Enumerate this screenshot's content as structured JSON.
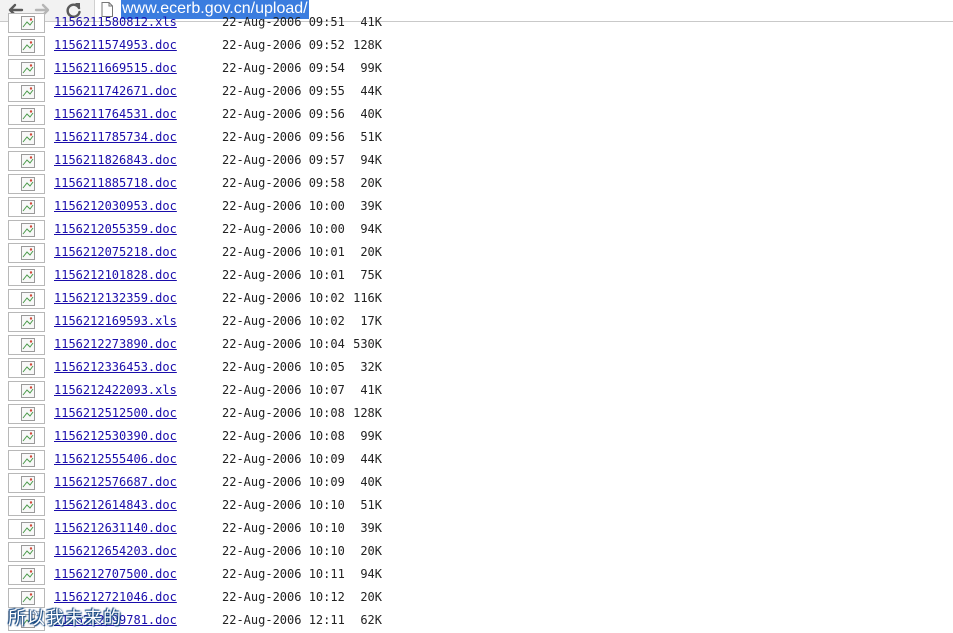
{
  "browser": {
    "url": "www.ecerb.gov.cn/upload/",
    "back_icon": "arrow-left-icon",
    "forward_icon": "arrow-right-icon",
    "reload_icon": "reload-icon",
    "page_icon": "document-icon"
  },
  "listing": {
    "rows": [
      {
        "name": "1156211580812.xls",
        "date": "22-Aug-2006 09:51",
        "size": "41K"
      },
      {
        "name": "1156211574953.doc",
        "date": "22-Aug-2006 09:52",
        "size": "128K"
      },
      {
        "name": "1156211669515.doc",
        "date": "22-Aug-2006 09:54",
        "size": "99K"
      },
      {
        "name": "1156211742671.doc",
        "date": "22-Aug-2006 09:55",
        "size": "44K"
      },
      {
        "name": "1156211764531.doc",
        "date": "22-Aug-2006 09:56",
        "size": "40K"
      },
      {
        "name": "1156211785734.doc",
        "date": "22-Aug-2006 09:56",
        "size": "51K"
      },
      {
        "name": "1156211826843.doc",
        "date": "22-Aug-2006 09:57",
        "size": "94K"
      },
      {
        "name": "1156211885718.doc",
        "date": "22-Aug-2006 09:58",
        "size": "20K"
      },
      {
        "name": "1156212030953.doc",
        "date": "22-Aug-2006 10:00",
        "size": "39K"
      },
      {
        "name": "1156212055359.doc",
        "date": "22-Aug-2006 10:00",
        "size": "94K"
      },
      {
        "name": "1156212075218.doc",
        "date": "22-Aug-2006 10:01",
        "size": "20K"
      },
      {
        "name": "1156212101828.doc",
        "date": "22-Aug-2006 10:01",
        "size": "75K"
      },
      {
        "name": "1156212132359.doc",
        "date": "22-Aug-2006 10:02",
        "size": "116K"
      },
      {
        "name": "1156212169593.xls",
        "date": "22-Aug-2006 10:02",
        "size": "17K"
      },
      {
        "name": "1156212273890.doc",
        "date": "22-Aug-2006 10:04",
        "size": "530K"
      },
      {
        "name": "1156212336453.doc",
        "date": "22-Aug-2006 10:05",
        "size": "32K"
      },
      {
        "name": "1156212422093.xls",
        "date": "22-Aug-2006 10:07",
        "size": "41K"
      },
      {
        "name": "1156212512500.doc",
        "date": "22-Aug-2006 10:08",
        "size": "128K"
      },
      {
        "name": "1156212530390.doc",
        "date": "22-Aug-2006 10:08",
        "size": "99K"
      },
      {
        "name": "1156212555406.doc",
        "date": "22-Aug-2006 10:09",
        "size": "44K"
      },
      {
        "name": "1156212576687.doc",
        "date": "22-Aug-2006 10:09",
        "size": "40K"
      },
      {
        "name": "1156212614843.doc",
        "date": "22-Aug-2006 10:10",
        "size": "51K"
      },
      {
        "name": "1156212631140.doc",
        "date": "22-Aug-2006 10:10",
        "size": "39K"
      },
      {
        "name": "1156212654203.doc",
        "date": "22-Aug-2006 10:10",
        "size": "20K"
      },
      {
        "name": "1156212707500.doc",
        "date": "22-Aug-2006 10:11",
        "size": "94K"
      },
      {
        "name": "1156212721046.doc",
        "date": "22-Aug-2006 10:12",
        "size": "20K"
      },
      {
        "name": "1156212799781.doc",
        "date": "22-Aug-2006 12:11",
        "size": "62K"
      }
    ]
  },
  "watermark": {
    "text": "所以我未来的"
  },
  "colors": {
    "link": "#1a0dab",
    "selection": "#3b7ddf"
  }
}
